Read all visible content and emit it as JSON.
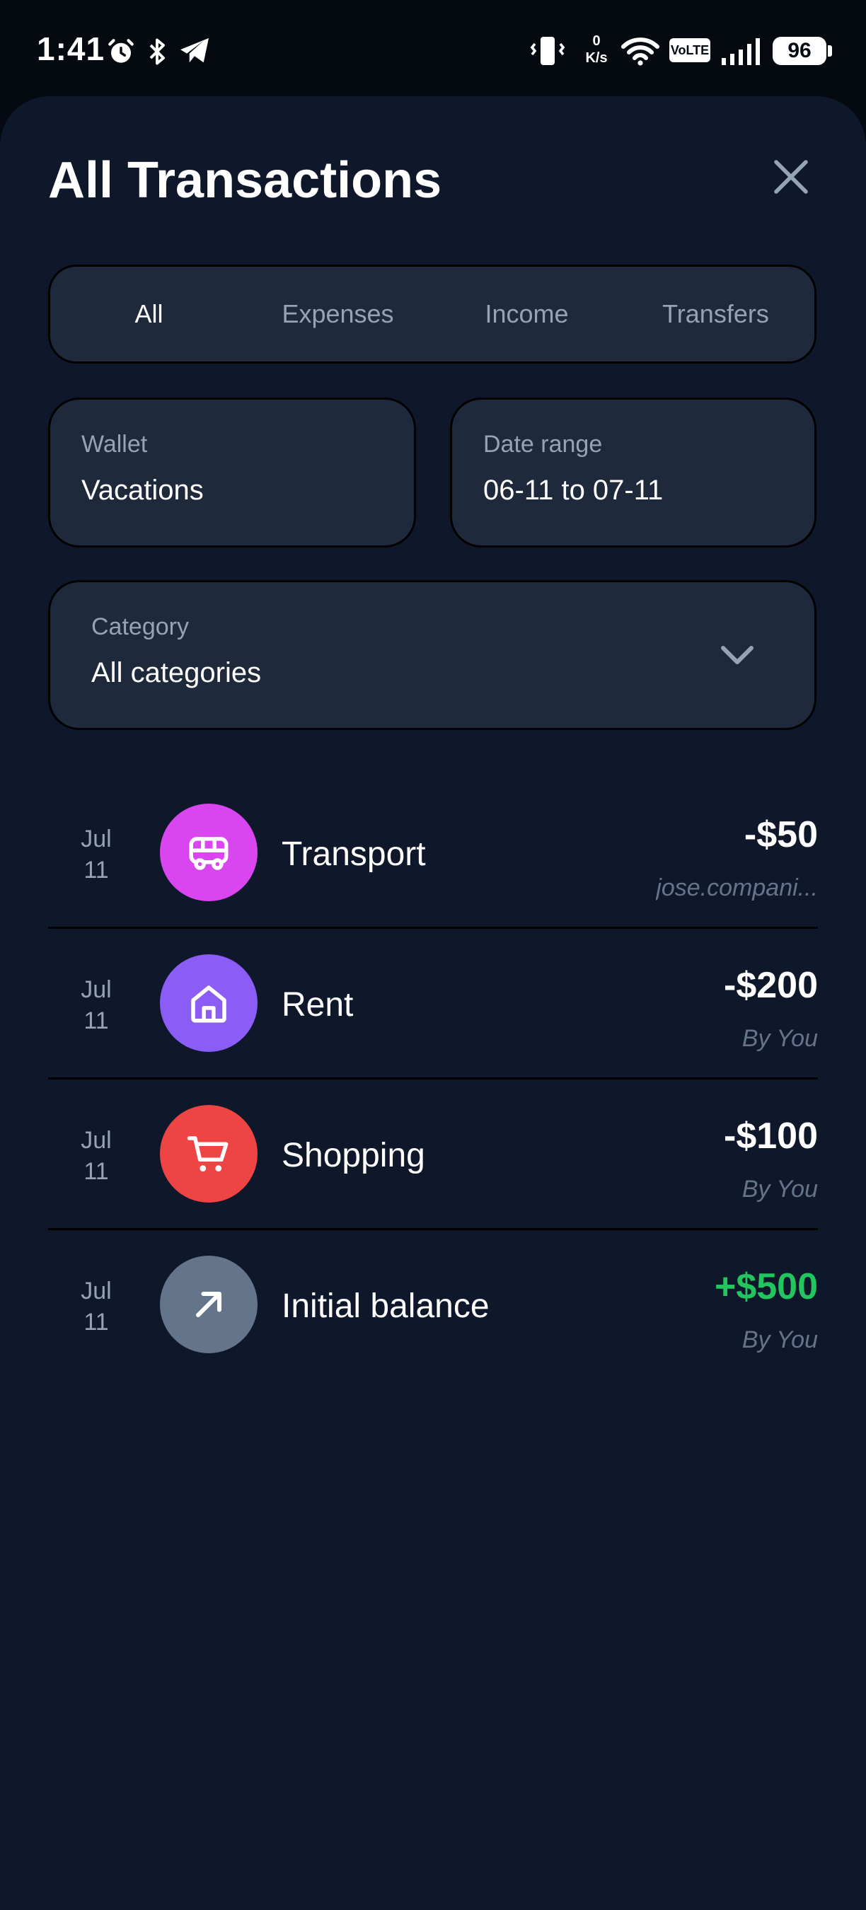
{
  "status_bar": {
    "time": "1:41",
    "network_speed": "0\nK/s",
    "volte": "VoLTE",
    "battery": "96"
  },
  "sheet": {
    "title": "All Transactions"
  },
  "tabs": [
    {
      "label": "All",
      "active": true
    },
    {
      "label": "Expenses",
      "active": false
    },
    {
      "label": "Income",
      "active": false
    },
    {
      "label": "Transfers",
      "active": false
    }
  ],
  "filters": {
    "wallet": {
      "label": "Wallet",
      "value": "Vacations"
    },
    "date_range": {
      "label": "Date range",
      "value": "06-11 to 07-11"
    },
    "category": {
      "label": "Category",
      "value": "All categories"
    }
  },
  "transactions": [
    {
      "month": "Jul",
      "day": "11",
      "name": "Transport",
      "amount": "-$50",
      "by": "jose.compani...",
      "icon": "bus-icon",
      "color": "#d946ef"
    },
    {
      "month": "Jul",
      "day": "11",
      "name": "Rent",
      "amount": "-$200",
      "by": "By You",
      "icon": "home-icon",
      "color": "#8b5cf6"
    },
    {
      "month": "Jul",
      "day": "11",
      "name": "Shopping",
      "amount": "-$100",
      "by": "By You",
      "icon": "cart-icon",
      "color": "#ef4444"
    },
    {
      "month": "Jul",
      "day": "11",
      "name": "Initial balance",
      "amount": "+$500",
      "by": "By You",
      "icon": "arrow-up-right-icon",
      "color": "#64748b"
    }
  ],
  "colors": {
    "background": "#0f172a",
    "card": "#1e293b",
    "income": "#22c55e"
  }
}
